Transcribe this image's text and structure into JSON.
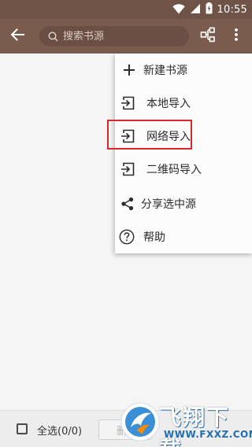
{
  "status_bar": {
    "time": "10:55",
    "icons": [
      "wifi-icon",
      "signal-icon",
      "battery-charging-icon"
    ]
  },
  "app_bar": {
    "search_placeholder": "搜索书源",
    "icons": [
      "back-arrow-icon",
      "search-icon",
      "group-icon",
      "more-vert-icon"
    ]
  },
  "menu": {
    "items": [
      {
        "label": "新建书源",
        "icon": "plus-icon"
      },
      {
        "label": "本地导入",
        "icon": "import-icon"
      },
      {
        "label": "网络导入",
        "icon": "import-icon"
      },
      {
        "label": "二维码导入",
        "icon": "import-icon"
      },
      {
        "label": "分享选中源",
        "icon": "share-icon"
      },
      {
        "label": "帮助",
        "icon": "help-icon"
      }
    ],
    "highlighted_item": "网络导入",
    "highlight_color": "#d8282e"
  },
  "bottom_bar": {
    "select_all_label": "全选(0/0)",
    "button_partial_label": "删"
  },
  "watermark": {
    "url": "WWW.FXXZ.COM",
    "brand": "飞翔下载"
  },
  "colors": {
    "app_bar": "#7a5c4f",
    "status_bar": "#6f5347",
    "background": "#f6f5f5"
  }
}
